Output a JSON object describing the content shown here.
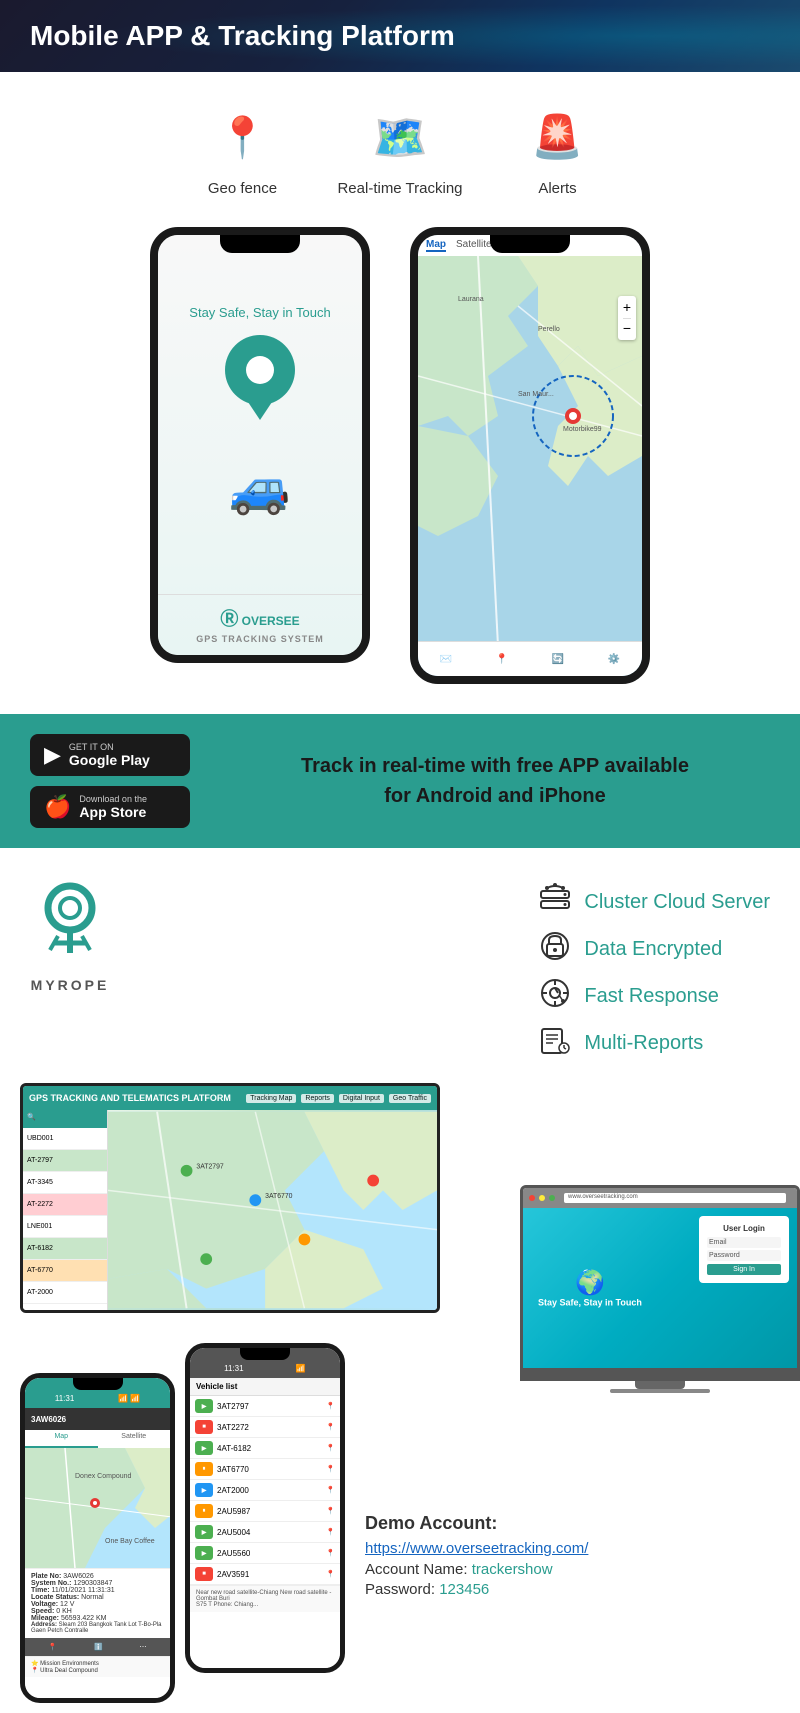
{
  "header": {
    "title": "Mobile APP & Tracking Platform"
  },
  "features": {
    "items": [
      {
        "label": "Geo fence",
        "icon": "📍"
      },
      {
        "label": "Real-time Tracking",
        "icon": "🗺️"
      },
      {
        "label": "Alerts",
        "icon": "🚨"
      }
    ]
  },
  "app_tagline": "Stay Safe, Stay in Touch",
  "app_logo": "Ⓡ OVERSEE\nGPS TRACKING SYSTEM",
  "appstore": {
    "google_play_pre": "GET IT ON",
    "google_play": "Google Play",
    "app_store_pre": "Download on the",
    "app_store": "App Store",
    "promo_text": "Track in real-time with free APP available\nfor Android and iPhone"
  },
  "myrope": {
    "name": "MYROPE"
  },
  "platform_features": {
    "items": [
      {
        "label": "Cluster Cloud Server"
      },
      {
        "label": "Data Encrypted"
      },
      {
        "label": "Fast Response"
      },
      {
        "label": "Multi-Reports"
      }
    ]
  },
  "demo": {
    "title": "Demo Account:",
    "link": "https://www.overseetracking.com/",
    "account_label": "Account Name:",
    "account_value": "trackershow",
    "password_label": "Password:",
    "password_value": "123456"
  },
  "vehicle_list": {
    "header": "Vehicle list",
    "items": [
      {
        "id": "3AT2797",
        "color": "green"
      },
      {
        "id": "3AT2272",
        "color": "red"
      },
      {
        "id": "4AT-6182",
        "color": "green"
      },
      {
        "id": "3AT6770",
        "color": "orange"
      },
      {
        "id": "2AT2000",
        "color": "blue"
      },
      {
        "id": "2AU5987",
        "color": "orange"
      },
      {
        "id": "2AU5004",
        "color": "green"
      },
      {
        "id": "2AU5560",
        "color": "green"
      },
      {
        "id": "2AV3591",
        "color": "red"
      }
    ]
  },
  "tracking_url": "GPS TRACKING AND TELEMATICS PLATFORM"
}
